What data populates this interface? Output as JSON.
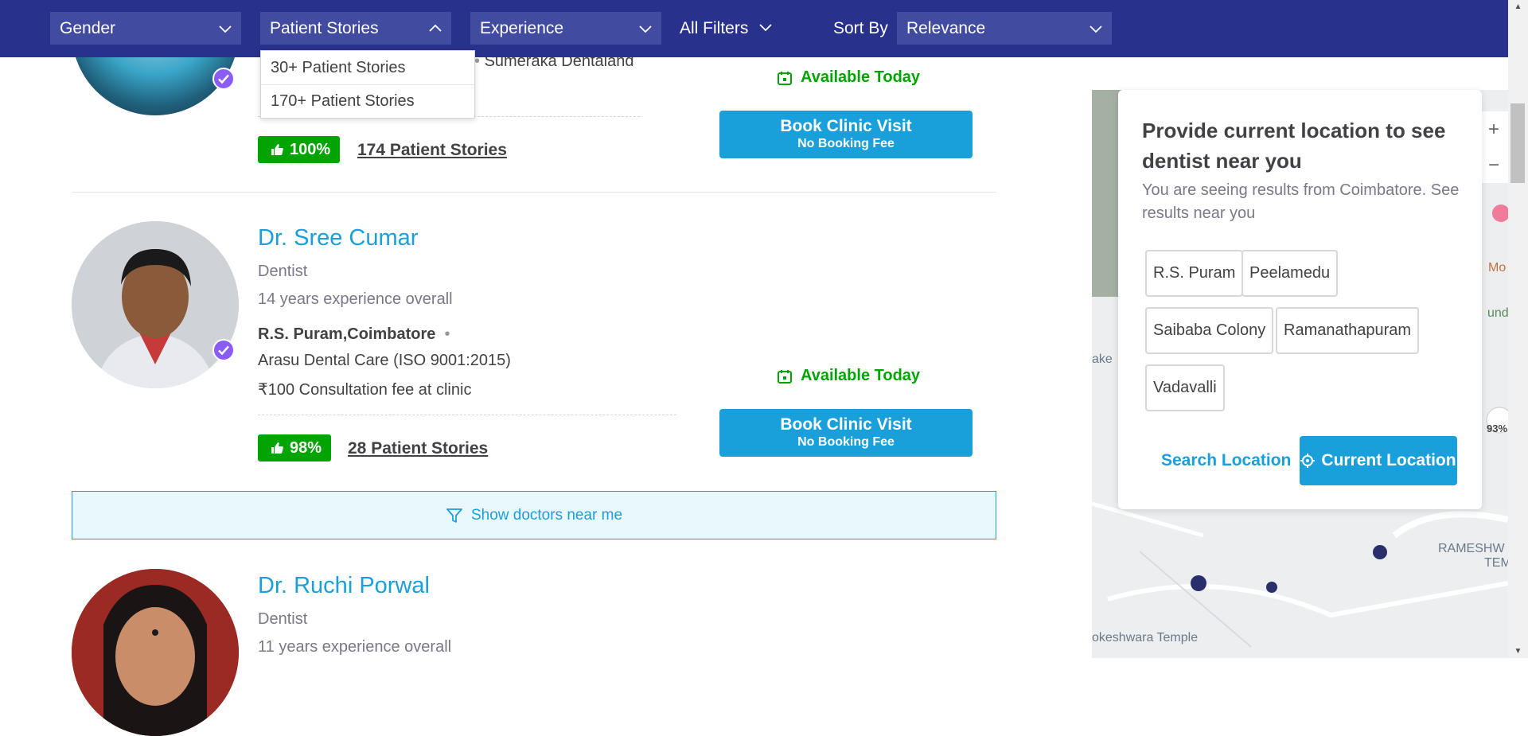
{
  "filters": {
    "gender": "Gender",
    "patient_stories": "Patient Stories",
    "experience": "Experience",
    "all_filters": "All Filters",
    "sort_by_label": "Sort By",
    "sort_by_value": "Relevance"
  },
  "dropdown": {
    "options": [
      "30+ Patient Stories",
      "170+ Patient Stories"
    ]
  },
  "doctors": [
    {
      "clinic_partial": "Sumeraka Dentaland",
      "availability": "Available Today",
      "book_label": "Book Clinic Visit",
      "book_sub": "No Booking Fee",
      "rating": "100%",
      "stories": "174 Patient Stories"
    },
    {
      "name": "Dr. Sree Cumar",
      "specialty": "Dentist",
      "experience": "14 years experience overall",
      "location": "R.S. Puram,Coimbatore",
      "clinic": "Arasu Dental Care (ISO 9001:2015)",
      "fee": "₹100 Consultation fee at clinic",
      "availability": "Available Today",
      "book_label": "Book Clinic Visit",
      "book_sub": "No Booking Fee",
      "rating": "98%",
      "stories": "28 Patient Stories"
    },
    {
      "name": "Dr. Ruchi Porwal",
      "specialty": "Dentist",
      "experience": "11 years experience overall"
    }
  ],
  "near_me": "Show doctors near me",
  "location_panel": {
    "title": "Provide current location to see dentist near you",
    "subtitle": "You are seeing results from Coimbatore. See results near you",
    "chips": [
      "R.S. Puram",
      "Peelamedu",
      "Saibaba Colony",
      "Ramanathapuram",
      "Vadavalli"
    ],
    "search_location": "Search Location",
    "current_location": "Current Location"
  },
  "map": {
    "zoom_in": "+",
    "zoom_out": "−",
    "labels": [
      "ake",
      "RAMESHW",
      "TEM",
      "okeshwara Temple",
      "Mo",
      "und",
      "93%"
    ]
  },
  "colors": {
    "header": "#28328c",
    "accent": "#199fd9",
    "green": "#01a400",
    "verified": "#8a5cf6"
  }
}
